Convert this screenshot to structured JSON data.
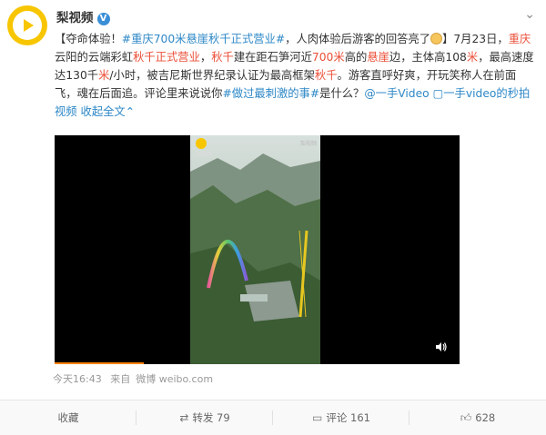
{
  "author": {
    "name": "梨视频",
    "verified_mark": "V"
  },
  "post": {
    "segments": [
      {
        "t": "【夺命体验！",
        "c": "plain"
      },
      {
        "t": "#重庆700米悬崖秋千正式营业#",
        "c": "link"
      },
      {
        "t": "，人肉体验后游客的回答亮了",
        "c": "plain"
      },
      {
        "t": "】7月23日，",
        "c": "plain"
      },
      {
        "t": "重庆",
        "c": "hl"
      },
      {
        "t": "云阳的云端彩虹",
        "c": "plain"
      },
      {
        "t": "秋千正式营业",
        "c": "hl"
      },
      {
        "t": "，",
        "c": "plain"
      },
      {
        "t": "秋千",
        "c": "hl"
      },
      {
        "t": "建在距石笋河近",
        "c": "plain"
      },
      {
        "t": "700米",
        "c": "hl"
      },
      {
        "t": "高的",
        "c": "plain"
      },
      {
        "t": "悬崖",
        "c": "hl"
      },
      {
        "t": "边，主体高108",
        "c": "plain"
      },
      {
        "t": "米",
        "c": "hl"
      },
      {
        "t": "，最高速度达130千",
        "c": "plain"
      },
      {
        "t": "米",
        "c": "hl"
      },
      {
        "t": "/小时，被吉尼斯世界纪录认证为最高框架",
        "c": "plain"
      },
      {
        "t": "秋千",
        "c": "hl"
      },
      {
        "t": "。游客直呼好爽，开玩笑称人在前面飞，魂在后面追。评论里来说说你",
        "c": "plain"
      },
      {
        "t": "#做过最刺激的事#",
        "c": "link"
      },
      {
        "t": "是什么？",
        "c": "plain"
      },
      {
        "t": "@一手Video",
        "c": "link"
      },
      {
        "t": " ",
        "c": "plain"
      },
      {
        "t": "▢一手video的秒拍视频",
        "c": "link"
      },
      {
        "t": " ",
        "c": "plain"
      },
      {
        "t": "收起全文",
        "c": "link"
      },
      {
        "t": "⌃",
        "c": "link"
      }
    ]
  },
  "video": {
    "logo_text": "梨视频",
    "watermark": "梨视频",
    "progress_fraction": 0.22
  },
  "meta": {
    "time": "今天16:43",
    "source_prefix": "来自",
    "source": "微博 weibo.com"
  },
  "actions": {
    "favorite": "收藏",
    "repost": "转发 79",
    "comment": "评论 161",
    "like": "628"
  },
  "colors": {
    "highlight": "#eb4f38",
    "link": "#2e88c7",
    "brand": "#f7c600"
  }
}
